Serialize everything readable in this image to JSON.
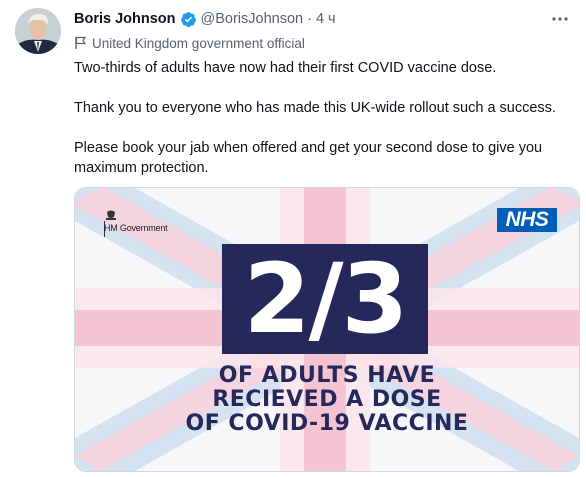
{
  "tweet": {
    "author_name": "Boris Johnson",
    "handle": "@BorisJohnson",
    "separator": "·",
    "time": "4 ч",
    "label": "United Kingdom government official",
    "paragraphs": [
      "Two-thirds of adults have now had their first COVID vaccine dose.",
      "Thank you to everyone who has made this UK-wide rollout such a success.",
      "Please book your jab when offered and get your second dose to give you maximum protection."
    ]
  },
  "image": {
    "logo_text": "HM Government",
    "nhs_text": "NHS",
    "fraction": "2/3",
    "caption_lines": [
      "OF ADULTS HAVE",
      "RECIEVED A DOSE",
      "OF COVID-19 VACCINE"
    ]
  },
  "colors": {
    "verified": "#1d9bf0",
    "muted_text": "#536471",
    "nhs_blue": "#005eb8",
    "navy": "#24285b",
    "flag_pink": "#f2b8c8",
    "flag_blue": "#b8d4e8"
  },
  "icons": {
    "verified": "verified-badge-icon",
    "label": "flag-icon",
    "more": "more-options-icon"
  }
}
